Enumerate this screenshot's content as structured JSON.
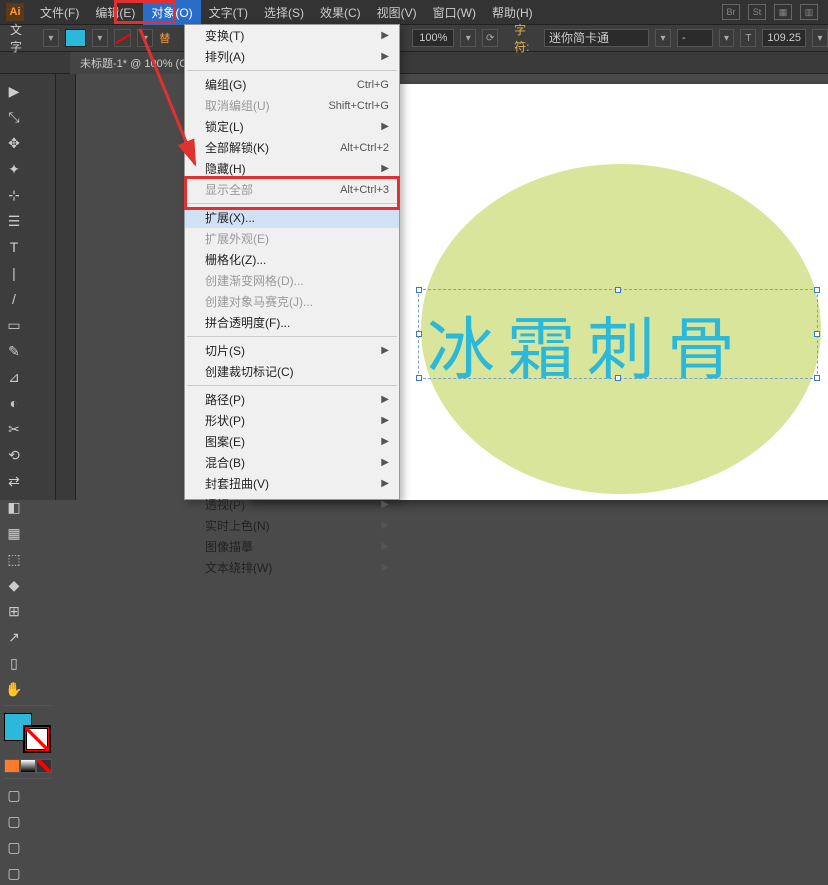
{
  "menubar": {
    "items": [
      "文件(F)",
      "编辑(E)",
      "对象(O)",
      "文字(T)",
      "选择(S)",
      "效果(C)",
      "视图(V)",
      "窗口(W)",
      "帮助(H)"
    ],
    "active_index": 2
  },
  "toolbar": {
    "label": "文字",
    "replace": "替",
    "zoom": "100%",
    "font_label": "字符:",
    "font_name": "迷你简卡通",
    "font_size": "109.25"
  },
  "tab": {
    "title": "未标题-1* @ 100% (C"
  },
  "dropdown": {
    "items": [
      {
        "label": "变换(T)",
        "arrow": true
      },
      {
        "label": "排列(A)",
        "arrow": true
      },
      {
        "sep": true
      },
      {
        "label": "编组(G)",
        "shortcut": "Ctrl+G"
      },
      {
        "label": "取消编组(U)",
        "shortcut": "Shift+Ctrl+G",
        "disabled": true
      },
      {
        "label": "锁定(L)",
        "arrow": true
      },
      {
        "label": "全部解锁(K)",
        "shortcut": "Alt+Ctrl+2"
      },
      {
        "label": "隐藏(H)",
        "arrow": true
      },
      {
        "label": "显示全部",
        "shortcut": "Alt+Ctrl+3",
        "disabled": true
      },
      {
        "sep": true
      },
      {
        "label": "扩展(X)...",
        "hover": true
      },
      {
        "label": "扩展外观(E)",
        "disabled": true
      },
      {
        "label": "栅格化(Z)..."
      },
      {
        "label": "创建渐变网格(D)...",
        "disabled": true
      },
      {
        "label": "创建对象马赛克(J)...",
        "disabled": true
      },
      {
        "label": "拼合透明度(F)..."
      },
      {
        "sep": true
      },
      {
        "label": "切片(S)",
        "arrow": true
      },
      {
        "label": "创建裁切标记(C)"
      },
      {
        "sep": true
      },
      {
        "label": "路径(P)",
        "arrow": true
      },
      {
        "label": "形状(P)",
        "arrow": true
      },
      {
        "label": "图案(E)",
        "arrow": true
      },
      {
        "label": "混合(B)",
        "arrow": true
      },
      {
        "label": "封套扭曲(V)",
        "arrow": true
      },
      {
        "label": "透视(P)",
        "arrow": true
      },
      {
        "label": "实时上色(N)",
        "arrow": true
      },
      {
        "label": "图像描摹",
        "arrow": true
      },
      {
        "label": "文本绕排(W)",
        "arrow": true
      }
    ]
  },
  "canvas": {
    "text": "冰霜刺骨"
  }
}
